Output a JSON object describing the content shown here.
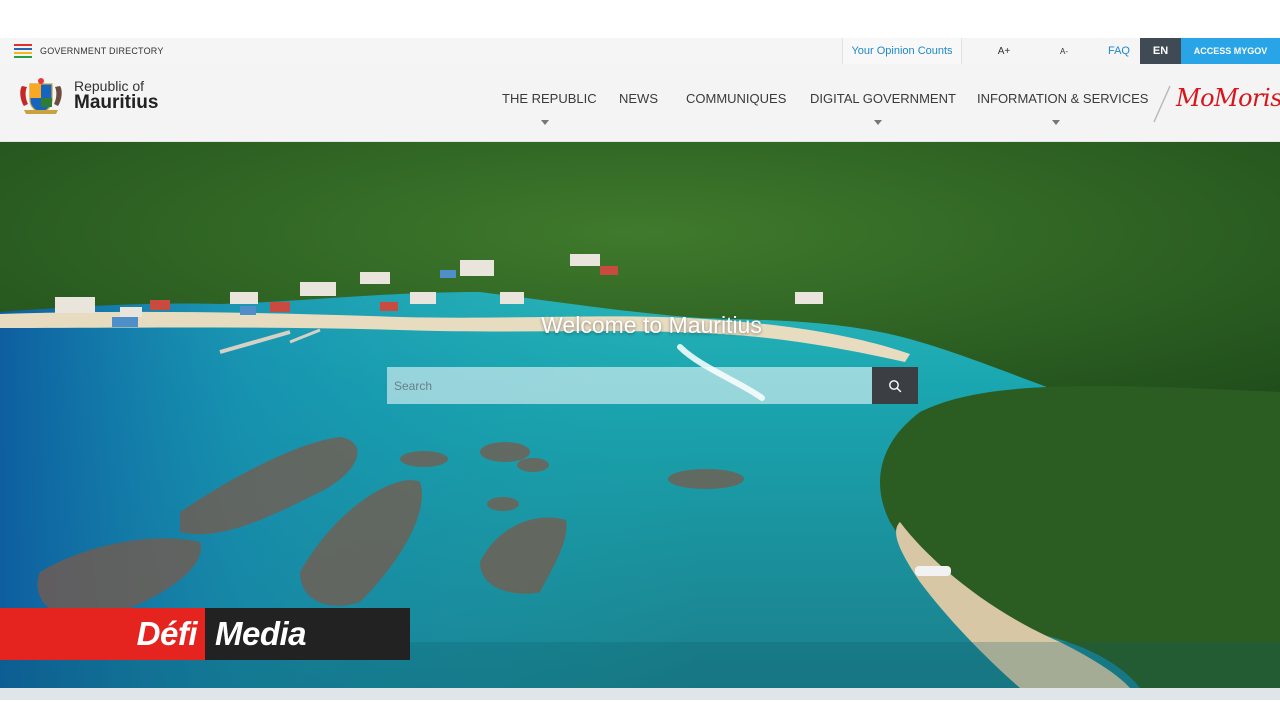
{
  "topbar": {
    "government_directory": "GOVERNMENT DIRECTORY",
    "opinion": "Your Opinion Counts",
    "font_increase": "A+",
    "font_decrease": "A-",
    "faq": "FAQ",
    "language": "EN",
    "access": "ACCESS MYGOV"
  },
  "brand": {
    "line1": "Republic of",
    "line2": "Mauritius",
    "crest_icon": "coat-of-arms-icon"
  },
  "nav": {
    "items": [
      {
        "label": "THE REPUBLIC",
        "dropdown": true
      },
      {
        "label": "NEWS",
        "dropdown": false
      },
      {
        "label": "COMMUNIQUES",
        "dropdown": false
      },
      {
        "label": "DIGITAL GOVERNMENT",
        "dropdown": true
      },
      {
        "label": "INFORMATION & SERVICES",
        "dropdown": true
      }
    ],
    "partner_logo": "MoMoris"
  },
  "hero": {
    "title": "Welcome to Mauritius",
    "search_placeholder": "Search",
    "search_icon": "search-icon"
  },
  "watermark": {
    "part1": "Défi",
    "part2": "Media"
  },
  "colors": {
    "accent_blue": "#29a4e6",
    "link_blue": "#1e88c8",
    "language_bg": "#3f4a54",
    "momoris_red": "#d6161c",
    "defi_red": "#e5241f"
  }
}
